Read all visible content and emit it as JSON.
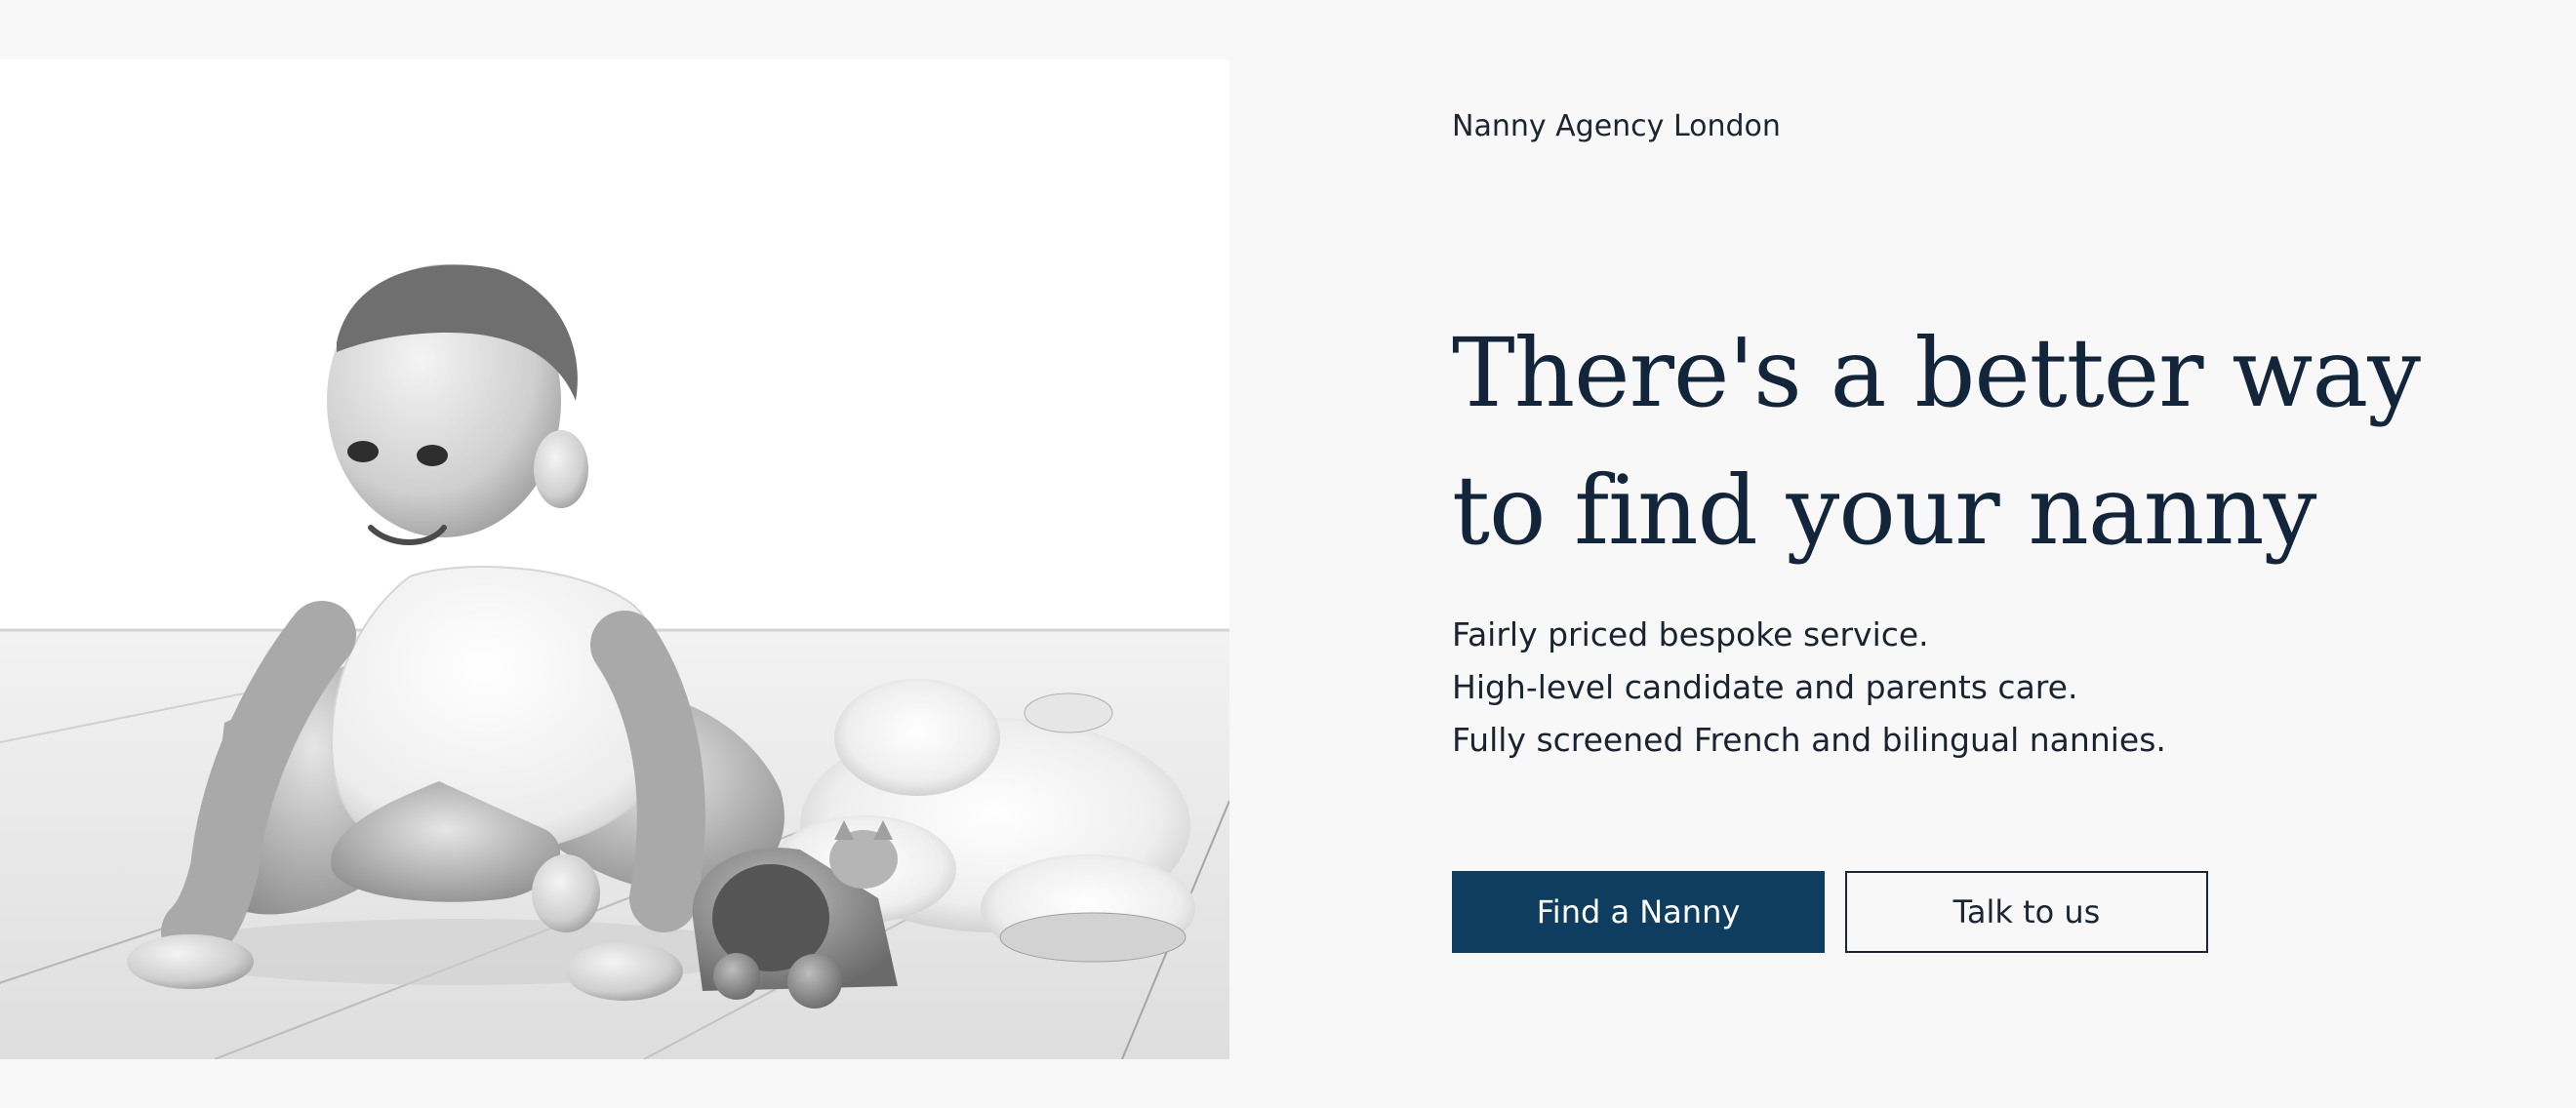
{
  "brand": {
    "name": "Nanny Agency London"
  },
  "hero": {
    "headline_line1": "There's a better way",
    "headline_line2": "to find your nanny",
    "features": [
      "Fairly priced bespoke service.",
      "High-level candidate and parents care.",
      "Fully screened French and bilingual nannies."
    ],
    "primary_button": "Find a Nanny",
    "secondary_button": "Talk to us"
  },
  "colors": {
    "page_background": "#f8f8f8",
    "heading": "#13253b",
    "primary_button_bg": "#0f3d5f",
    "primary_button_text": "#ffffff",
    "secondary_button_border": "#1b2634"
  }
}
